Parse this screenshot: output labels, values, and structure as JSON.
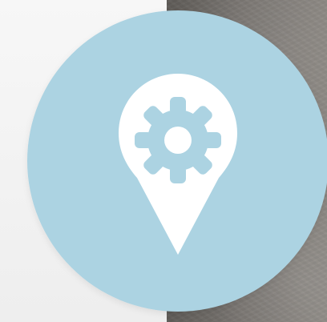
{
  "icon": {
    "name": "location-gear-icon",
    "circle_color": "#acd3e2",
    "pin_color": "#ffffff",
    "gear_color": "#acd3e2",
    "background_left_color": "#f1f1f1",
    "background_right_color": "#7a7672"
  }
}
